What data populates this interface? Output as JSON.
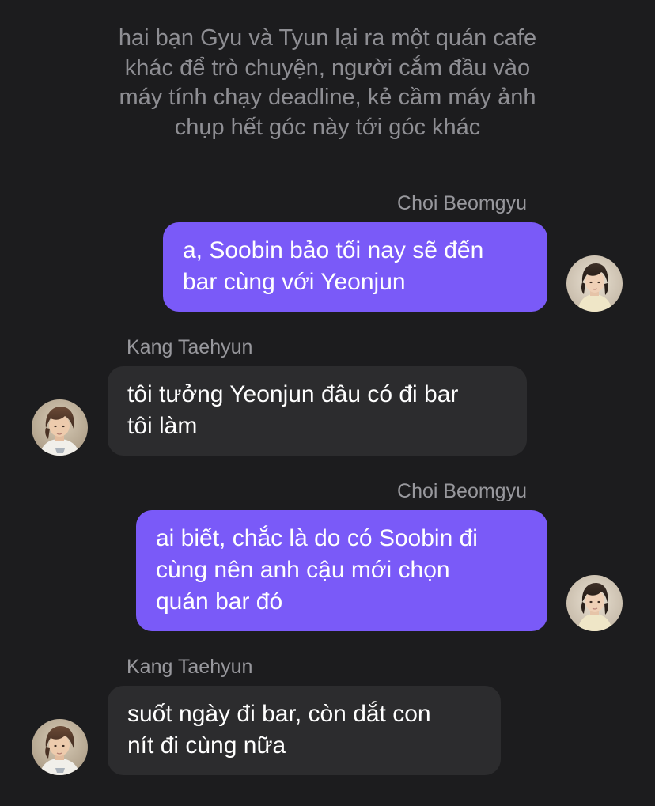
{
  "narration": {
    "lines": [
      "hai bạn Gyu và Tyun lại ra một quán cafe",
      "khác để trò chuyện, người cắm đầu vào",
      "máy tính chạy deadline, kẻ cầm máy ảnh",
      "chụp hết góc này tới góc khác"
    ]
  },
  "messages": [
    {
      "sender": "Choi Beomgyu",
      "direction": "outgoing",
      "lines": [
        "a, Soobin bảo tối nay sẽ đến",
        "bar cùng với Yeonjun"
      ]
    },
    {
      "sender": "Kang Taehyun",
      "direction": "incoming",
      "lines": [
        "tôi tưởng Yeonjun đâu có đi bar",
        "tôi làm"
      ]
    },
    {
      "sender": "Choi Beomgyu",
      "direction": "outgoing",
      "lines": [
        "ai biết, chắc là do có Soobin đi",
        "cùng nên anh cậu mới chọn",
        "quán bar đó"
      ]
    },
    {
      "sender": "Kang Taehyun",
      "direction": "incoming",
      "lines": [
        "suốt ngày đi bar, còn dắt con",
        "nít đi cùng nữa"
      ]
    }
  ],
  "colors": {
    "background": "#1c1c1e",
    "outgoing_bubble": "#7a5af8",
    "incoming_bubble": "#2c2c2e",
    "narration_text": "#8e8e93",
    "sender_text": "#98989d"
  },
  "icons": {
    "beomgyu_avatar": "avatar-photo",
    "taehyun_avatar": "avatar-photo"
  }
}
